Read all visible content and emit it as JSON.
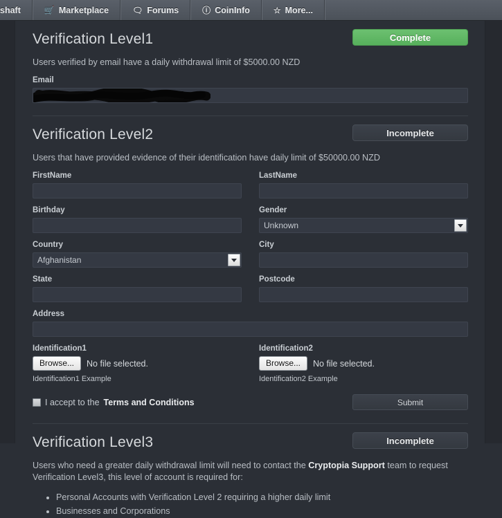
{
  "topnav": {
    "tabs": [
      {
        "label": "shaft",
        "icon": ""
      },
      {
        "label": "Marketplace",
        "icon": "cart-icon",
        "glyph": "Ὥ2"
      },
      {
        "label": "Forums",
        "icon": "speech-bubbles-icon",
        "glyph": "◰"
      },
      {
        "label": "CoinInfo",
        "icon": "info-circle-icon",
        "glyph": "ℹ"
      },
      {
        "label": "More...",
        "icon": "star-icon",
        "glyph": "☆"
      }
    ]
  },
  "level1": {
    "title": "Verification Level1",
    "status": "Complete",
    "status_color": "#5db262",
    "blurb": "Users verified by email have a daily withdrawal limit of $5000.00 NZD",
    "email_label": "Email",
    "email_value": ""
  },
  "level2": {
    "title": "Verification Level2",
    "status": "Incomplete",
    "blurb": "Users that have provided evidence of their identification have daily limit of $50000.00 NZD",
    "fields": {
      "firstname_label": "FirstName",
      "firstname_value": "",
      "lastname_label": "LastName",
      "lastname_value": "",
      "birthday_label": "Birthday",
      "birthday_value": "",
      "gender_label": "Gender",
      "gender_value": "Unknown",
      "country_label": "Country",
      "country_value": "Afghanistan",
      "city_label": "City",
      "city_value": "",
      "state_label": "State",
      "state_value": "",
      "postcode_label": "Postcode",
      "postcode_value": "",
      "address_label": "Address",
      "address_value": "",
      "id1_label": "Identification1",
      "id1_browse": "Browse...",
      "id1_file": "No file selected.",
      "id1_example": "Identification1 Example",
      "id2_label": "Identification2",
      "id2_browse": "Browse...",
      "id2_file": "No file selected.",
      "id2_example": "Identification2 Example"
    },
    "accept_prefix": "I accept to the",
    "accept_link": "Terms and Conditions",
    "submit_label": "Submit"
  },
  "level3": {
    "title": "Verification Level3",
    "status": "Incomplete",
    "blurb_part1": "Users who need a greater daily withdrawal limit will need to contact the",
    "blurb_link": "Cryptopia Support",
    "blurb_part2": "team to request Verification Level3, this level of account is required for:",
    "bullets": [
      "Personal Accounts with Verification Level 2 requiring a higher daily limit",
      "Businesses and Corporations"
    ]
  }
}
